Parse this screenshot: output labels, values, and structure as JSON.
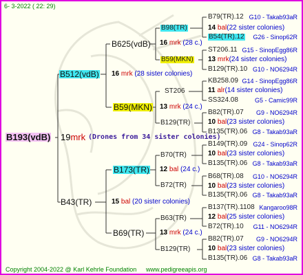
{
  "header": {
    "date": "6-  3-2022 ( 22: 29)"
  },
  "footer": {
    "copyright": "Copyright 2004-2022 @ Karl Kehrle Foundation",
    "site": "www.pedigreeapis.org"
  },
  "colors": {
    "frame": "#e000e0",
    "highlight_cyan": "#3fe7f0",
    "highlight_yellow": "#f0f000",
    "highlight_pink": "#f4c2f4",
    "mark_red": "#cc0000",
    "link_blue": "#0000cc",
    "date_green": "#008000"
  },
  "root": {
    "id": "B193(vdB)",
    "num": "19",
    "mrk": "mrk",
    "drones": "(Drones from 34 sister colonies)"
  },
  "gen1": {
    "top": {
      "id": "B512(vdB)",
      "num": "16",
      "mrk": "mrk",
      "sis": "(28 sister colonies)"
    },
    "bottom": {
      "id": "B43(TR)",
      "num": "15",
      "mrk": "bal",
      "sis": "(20 sister colonies)"
    }
  },
  "gen2": {
    "a": {
      "id": "B625(vdB)"
    },
    "b": {
      "id": "B59(MKN)",
      "num": "13",
      "mrk": "mrk",
      "sis": "(24 c.)"
    },
    "c": {
      "id": "B173(TR)",
      "num": "12",
      "mrk": "bal",
      "sis": "(24 c.)"
    },
    "d": {
      "id": "B69(TR)",
      "num": "13",
      "mrk": "mrk",
      "sis": "(24 c.)"
    }
  },
  "gen3": {
    "a1": {
      "id": "B98(TR)"
    },
    "a_mid": {
      "num": "16",
      "mrk": "mrk",
      "sis": "(28 c.)"
    },
    "a2": {
      "id": "B59(MKN)"
    },
    "b1": {
      "id": "ST206"
    },
    "b2": {
      "id": "B129(TR)"
    },
    "c1": {
      "id": "B70(TR)"
    },
    "c2": {
      "id": "B72(TR)"
    },
    "d1": {
      "id": "B63(TR)"
    },
    "d2": {
      "id": "B129(TR)"
    }
  },
  "gen4": [
    {
      "id": "B79(TR).12",
      "origin": "G10 - Takab93aR"
    },
    {
      "num": "14",
      "mrk": "bal",
      "sis": "(22 sister colonies)"
    },
    {
      "id": "B54(TR).12",
      "origin": "G26 - Sinop62R"
    },
    {
      "id": "ST206.11",
      "origin": "G15 - SinopEgg86R"
    },
    {
      "num": "13",
      "mrk": "mrk",
      "sis": "(24 sister colonies)"
    },
    {
      "id": "B129(TR).10",
      "origin": "G10 - NO6294R"
    },
    {
      "id": "KB258.09",
      "origin": "G14 - SinopEgg86R"
    },
    {
      "num": "11",
      "mrk": "alr",
      "sis": "(14 sister colonies)"
    },
    {
      "id": "SS324.08",
      "origin": "G5 - Camic99R"
    },
    {
      "id": "B82(TR).07",
      "origin": "G9 - NO6294R"
    },
    {
      "num": "10",
      "mrk": "bal",
      "sis": "(23 sister colonies)"
    },
    {
      "id": "B135(TR).06",
      "origin": "G8 - Takab93aR"
    },
    {
      "id": "B149(TR).09",
      "origin": "G24 - Sinop62R"
    },
    {
      "num": "10",
      "mrk": "bal",
      "sis": "(23 sister colonies)"
    },
    {
      "id": "B135(TR).06",
      "origin": "G8 - Takab93aR"
    },
    {
      "id": "B68(TR).08",
      "origin": "G10 - NO6294R"
    },
    {
      "num": "10",
      "mrk": "bal",
      "sis": "(23 sister colonies)"
    },
    {
      "id": "B135(TR).06",
      "origin": "G8 - Takab93aR"
    },
    {
      "id": "B137(TR).1108",
      "origin": "Kangaroo98R"
    },
    {
      "num": "12",
      "mrk": "bal",
      "sis": "(25 sister colonies)"
    },
    {
      "id": "B72(TR).10",
      "origin": "G11 - NO6294R"
    },
    {
      "id": "B82(TR).07",
      "origin": "G9 - NO6294R"
    },
    {
      "num": "10",
      "mrk": "bal",
      "sis": "(23 sister colonies)"
    },
    {
      "id": "B135(TR).06",
      "origin": "G8 - Takab93aR"
    }
  ]
}
